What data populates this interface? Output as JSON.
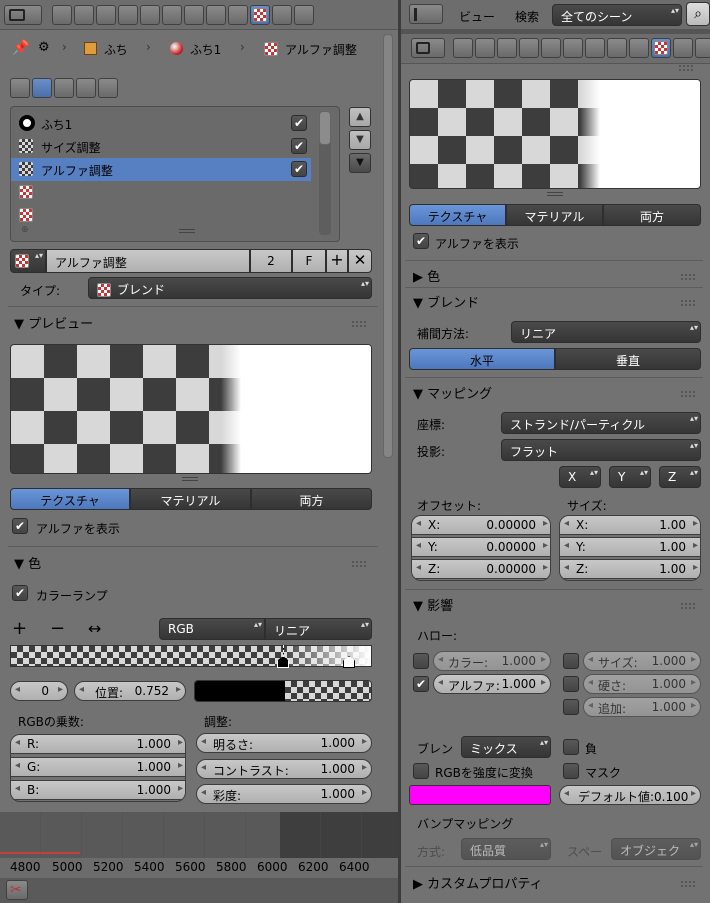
{
  "left": {
    "breadcrumb": {
      "item1": "ふち",
      "item2": "ふち1",
      "item3": "アルファ調整"
    },
    "slots": [
      {
        "label": "ふち1",
        "checked": true
      },
      {
        "label": "サイズ調整",
        "checked": true
      },
      {
        "label": "アルファ調整",
        "checked": true,
        "selected": true
      },
      {
        "label": ""
      },
      {
        "label": ""
      }
    ],
    "texture_name": "アルファ調整",
    "user_count": "2",
    "fake_user": "F",
    "type_label": "タイプ:",
    "type_value": "ブレンド",
    "preview_header": "プレビュー",
    "preview_tabs": [
      "テクスチャ",
      "マテリアル",
      "両方"
    ],
    "show_alpha": "アルファを表示",
    "color_header": "色",
    "color_ramp": "カラーランプ",
    "ramp_mode": "RGB",
    "ramp_interp": "リニア",
    "ramp_index": "0",
    "ramp_pos_label": "位置:",
    "ramp_pos_value": "0.752",
    "rgb_mult_label": "RGBの乗数:",
    "adjust_label": "調整:",
    "rgb_fields": [
      {
        "l": "R:",
        "v": "1.000"
      },
      {
        "l": "G:",
        "v": "1.000"
      },
      {
        "l": "B:",
        "v": "1.000"
      }
    ],
    "adjust_fields": [
      {
        "l": "明るさ:",
        "v": "1.000"
      },
      {
        "l": "コントラスト:",
        "v": "1.000"
      },
      {
        "l": "彩度:",
        "v": "1.000"
      }
    ],
    "timeline": [
      "4800",
      "5000",
      "5200",
      "5400",
      "5600",
      "5800",
      "6000",
      "6200",
      "6400"
    ]
  },
  "right": {
    "menu": {
      "view": "ビュー",
      "search": "検索",
      "scene": "全てのシーン"
    },
    "preview_tabs": [
      "テクスチャ",
      "マテリアル",
      "両方"
    ],
    "show_alpha": "アルファを表示",
    "color_header": "色",
    "blend_header": "ブレンド",
    "interp_label": "補間方法:",
    "interp_value": "リニア",
    "blend_dir": [
      "水平",
      "垂直"
    ],
    "mapping_header": "マッピング",
    "coords_label": "座標:",
    "coords_value": "ストランド/パーティクル",
    "projection_label": "投影:",
    "projection_value": "フラット",
    "axis": [
      "X",
      "Y",
      "Z"
    ],
    "offset_label": "オフセット:",
    "size_label": "サイズ:",
    "offset": [
      {
        "l": "X:",
        "v": "0.00000"
      },
      {
        "l": "Y:",
        "v": "0.00000"
      },
      {
        "l": "Z:",
        "v": "0.00000"
      }
    ],
    "size": [
      {
        "l": "X:",
        "v": "1.00"
      },
      {
        "l": "Y:",
        "v": "1.00"
      },
      {
        "l": "Z:",
        "v": "1.00"
      }
    ],
    "influence_header": "影響",
    "halo_label": "ハロー:",
    "influence": [
      {
        "l": "カラー:",
        "v": "1.000",
        "checked": false
      },
      {
        "l": "アルファ:",
        "v": "1.000",
        "checked": true
      }
    ],
    "influence_right": [
      {
        "l": "サイズ:",
        "v": "1.000"
      },
      {
        "l": "硬さ:",
        "v": "1.000"
      },
      {
        "l": "追加:",
        "v": "1.000"
      }
    ],
    "blend_label": "ブレン",
    "blend_value": "ミックス",
    "negative": "負",
    "rgb_to_intensity": "RGBを強度に変換",
    "mask": "マスク",
    "default_value": "デフォルト値:0.100",
    "bump_header": "バンプマッピング",
    "method_label": "方式:",
    "method_value": "低品質",
    "space_label": "スペー",
    "space_value": "オブジェク",
    "custom_props": "カスタムプロパティ",
    "magenta": "#ff00ff"
  }
}
